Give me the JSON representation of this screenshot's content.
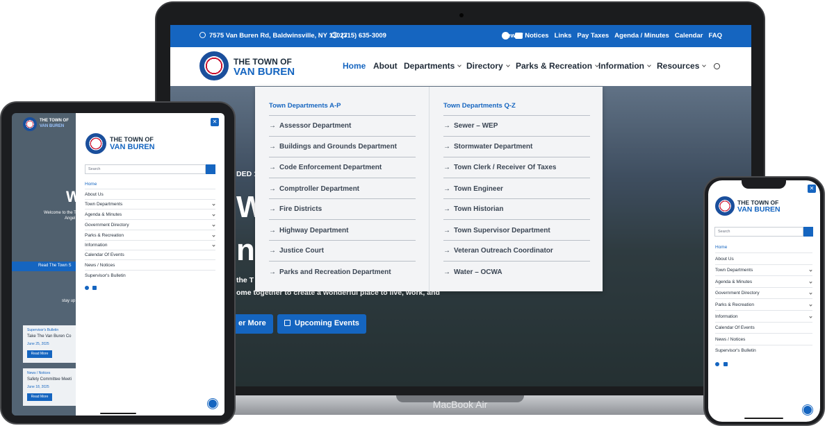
{
  "laptop": {
    "brand": "MacBook Air",
    "topbar": {
      "address": "7575 Van Buren Rd, Baldwinsville, NY 13027",
      "phone": "(315) 635-3009",
      "links": [
        "News / Notices",
        "Links",
        "Pay Taxes",
        "Agenda / Minutes",
        "Calendar",
        "FAQ"
      ]
    },
    "logo": {
      "line1": "THE TOWN OF",
      "line2": "VAN BUREN"
    },
    "nav": [
      "Home",
      "About",
      "Departments",
      "Directory",
      "Parks & Recreation",
      "Information",
      "Resources"
    ],
    "dropdown": {
      "left_heading": "Town Departments A-P",
      "left_items": [
        "Assessor Department",
        "Buildings and Grounds Department",
        "Code Enforcement Department",
        "Comptroller Department",
        "Fire Districts",
        "Highway Department",
        "Justice Court",
        "Parks and Recreation Department"
      ],
      "right_heading": "Town Departments Q-Z",
      "right_items": [
        "Sewer – WEP",
        "Stormwater Department",
        "Town Clerk / Receiver Of Taxes",
        "Town Engineer",
        "Town Historian",
        "Town Supervisor Department",
        "Veteran Outreach Coordinator",
        "Water – OCWA"
      ]
    },
    "hero": {
      "fragment_1": "DED 18",
      "fragment_2": "W",
      "fragment_3": "n",
      "fragment_4": "the T",
      "fragment_5": "ome together to create a wonderful place to live, work, and",
      "btn_more": "er More",
      "btn_events": "Upcoming Events"
    }
  },
  "tablet": {
    "logo": {
      "line1": "THE TOWN OF",
      "line2": "VAN BUREN"
    },
    "search_placeholder": "Search",
    "menu": [
      "Home",
      "About Us",
      "Town Departments",
      "Agenda & Minutes",
      "Government Directory",
      "Parks & Recreation",
      "Information",
      "Calendar Of Events",
      "News / Notices",
      "Supervisor's Bulletin"
    ],
    "bg": {
      "w": "W",
      "welcome": "Welcome to the T",
      "angel": "Angel",
      "band": "Read The Town S",
      "stay": "stay up",
      "card1_tag": "Supervisor's Bulletin",
      "card1_title": "Take The Van Buren Co",
      "card1_date": "June 25, 2025",
      "card2_tag": "News / Notices",
      "card2_title": "Safety Committee Meeti",
      "card2_date": "June 18, 2025",
      "read_more": "Read More"
    }
  },
  "phone": {
    "logo": {
      "line1": "THE TOWN OF",
      "line2": "VAN BUREN"
    },
    "search_placeholder": "Search",
    "menu": [
      "Home",
      "About Us",
      "Town Departments",
      "Agenda & Minutes",
      "Government Directory",
      "Parks & Recreation",
      "Information",
      "Calendar Of Events",
      "News / Notices",
      "Supervisor's Bulletin"
    ]
  }
}
